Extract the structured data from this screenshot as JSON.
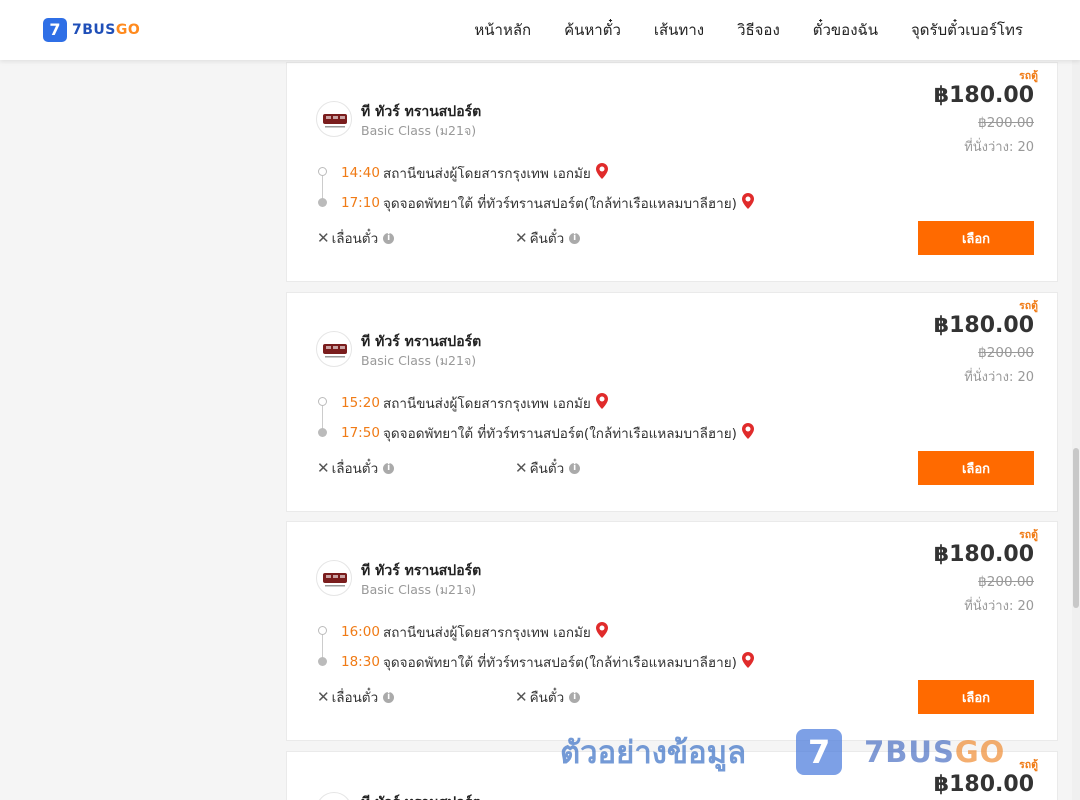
{
  "header": {
    "logo_mark": "7",
    "logo_text": "7BUS",
    "logo_text_accent": "GO",
    "nav": [
      "หน้าหลัก",
      "ค้นหาตั๋ว",
      "เส้นทาง",
      "วิธีจอง",
      "ตั๋วของฉัน",
      "จุดรับตั๋วเบอร์โทร"
    ]
  },
  "colors": {
    "accent": "#ff6a00",
    "time": "#f07b16",
    "brand": "#2f6fe6",
    "pin": "#e02b2b"
  },
  "trips": [
    {
      "operator": "ที ทัวร์ ทรานสปอร์ต",
      "bus_class": "Basic Class (ม21จ)",
      "vehicle_type": "รถตู้",
      "price": "฿180.00",
      "old_price": "฿200.00",
      "seats": "ที่นั่งว่าง: 20",
      "dep_time": "14:40",
      "dep_stop": "สถานีขนส่งผู้โดยสารกรุงเทพ เอกมัย",
      "arr_time": "17:10",
      "arr_stop": "จุดจอดพัทยาใต้ ที่ทัวร์ทรานสปอร์ต(ใกล้ท่าเรือแหลมบาลีฮาย)",
      "change_label": "เลื่อนตั๋ว",
      "refund_label": "คืนตั๋ว",
      "select_label": "เลือก"
    },
    {
      "operator": "ที ทัวร์ ทรานสปอร์ต",
      "bus_class": "Basic Class (ม21จ)",
      "vehicle_type": "รถตู้",
      "price": "฿180.00",
      "old_price": "฿200.00",
      "seats": "ที่นั่งว่าง: 20",
      "dep_time": "15:20",
      "dep_stop": "สถานีขนส่งผู้โดยสารกรุงเทพ เอกมัย",
      "arr_time": "17:50",
      "arr_stop": "จุดจอดพัทยาใต้ ที่ทัวร์ทรานสปอร์ต(ใกล้ท่าเรือแหลมบาลีฮาย)",
      "change_label": "เลื่อนตั๋ว",
      "refund_label": "คืนตั๋ว",
      "select_label": "เลือก"
    },
    {
      "operator": "ที ทัวร์ ทรานสปอร์ต",
      "bus_class": "Basic Class (ม21จ)",
      "vehicle_type": "รถตู้",
      "price": "฿180.00",
      "old_price": "฿200.00",
      "seats": "ที่นั่งว่าง: 20",
      "dep_time": "16:00",
      "dep_stop": "สถานีขนส่งผู้โดยสารกรุงเทพ เอกมัย",
      "arr_time": "18:30",
      "arr_stop": "จุดจอดพัทยาใต้ ที่ทัวร์ทรานสปอร์ต(ใกล้ท่าเรือแหลมบาลีฮาย)",
      "change_label": "เลื่อนตั๋ว",
      "refund_label": "คืนตั๋ว",
      "select_label": "เลือก"
    },
    {
      "operator": "ที ทัวร์ ทรานสปอร์ต",
      "vehicle_type": "รถตู้",
      "price": "฿180.00"
    }
  ],
  "watermark": {
    "text": "ตัวอย่างข้อมูล",
    "logo_mark": "7",
    "brand": "7BUS",
    "brand_accent": "GO"
  }
}
